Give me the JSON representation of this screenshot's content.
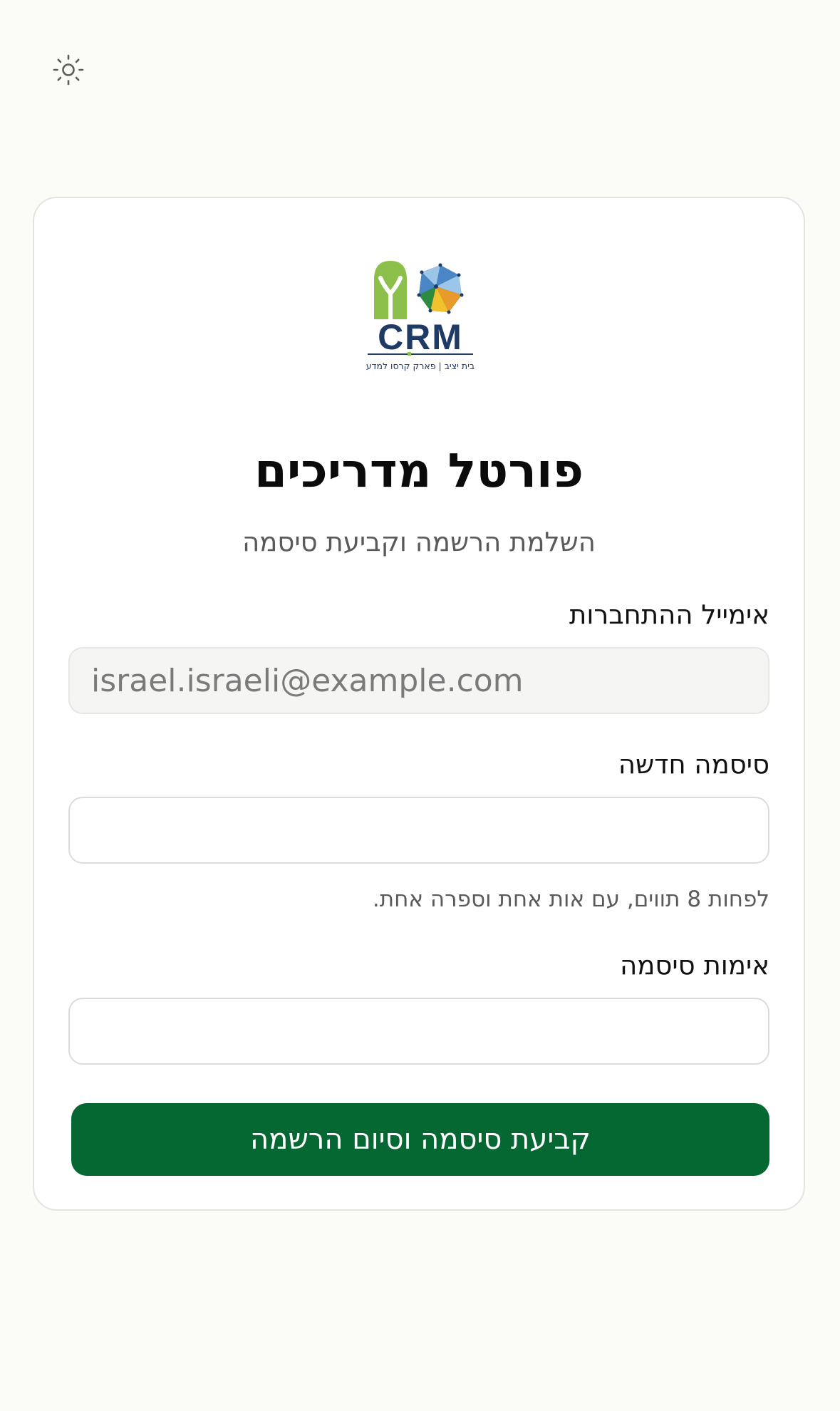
{
  "header": {
    "theme_toggle_icon": "sun-icon"
  },
  "logo": {
    "brand_text": "CRM",
    "tagline": "בית יציב | פארק קרסו למדע",
    "colors": {
      "arch_green": "#8cc04a",
      "navy": "#1f3a64",
      "blue": "#4a86c6",
      "light_blue": "#9cc6e8",
      "green": "#2e8a3e",
      "yellow": "#f2c12e",
      "orange": "#e89a2a"
    }
  },
  "card": {
    "title": "פורטל מדריכים",
    "subtitle": "השלמת הרשמה וקביעת סיסמה"
  },
  "form": {
    "email_label": "אימייל ההתחברות",
    "email_value": "israel.israeli@example.com",
    "new_password_label": "סיסמה חדשה",
    "new_password_value": "",
    "password_hint": "לפחות 8 תווים, עם אות אחת וספרה אחת.",
    "confirm_password_label": "אימות סיסמה",
    "confirm_password_value": "",
    "submit_label": "קביעת סיסמה וסיום הרשמה"
  },
  "colors": {
    "primary_button": "#056732",
    "page_background": "#fbfbf8",
    "card_border": "#e3e3e0"
  }
}
